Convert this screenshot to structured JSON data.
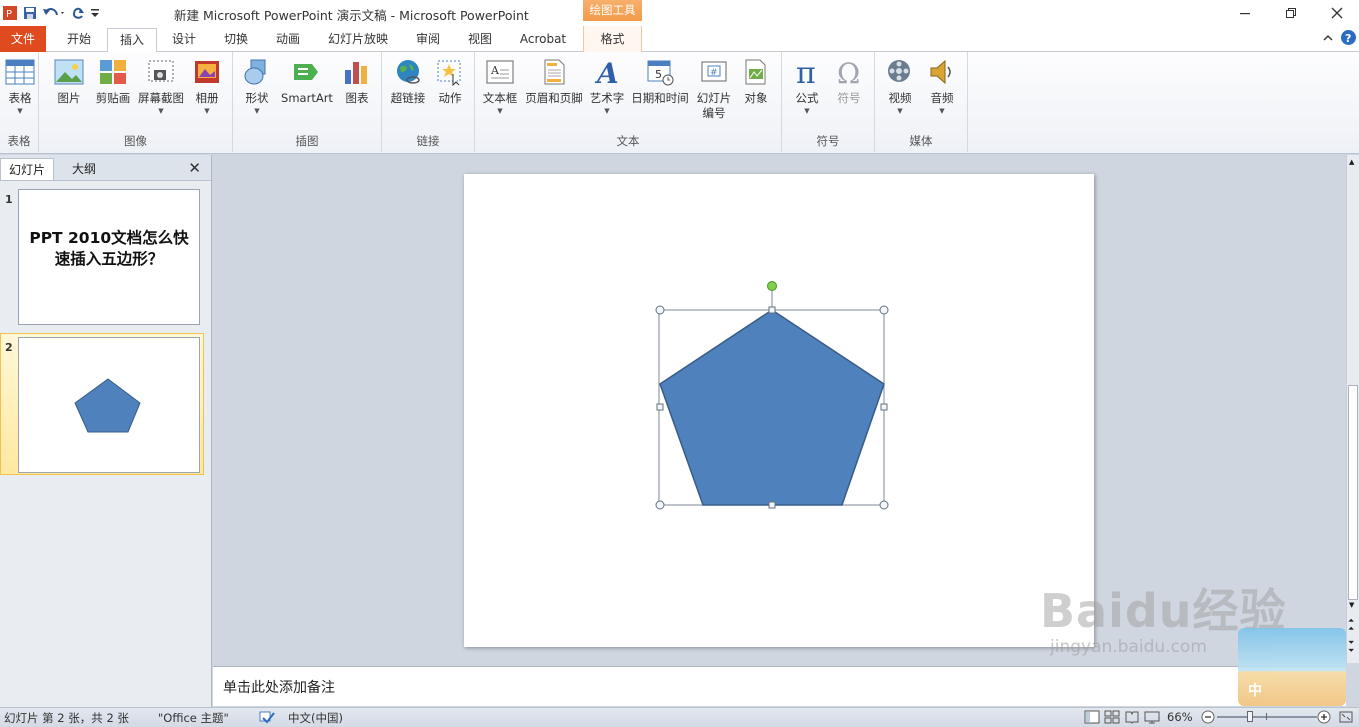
{
  "window": {
    "title": "新建 Microsoft PowerPoint 演示文稿 - Microsoft PowerPoint",
    "context_tab_header": "绘图工具",
    "controls": [
      "minimize-icon",
      "maximize-icon",
      "close-icon"
    ]
  },
  "quick_access": [
    "powerpoint-logo-icon",
    "save-icon",
    "undo-icon",
    "redo-icon",
    "customize-icon"
  ],
  "tabs": {
    "file": "文件",
    "home": "开始",
    "insert": "插入",
    "design": "设计",
    "transitions": "切换",
    "animations": "动画",
    "slideshow": "幻灯片放映",
    "review": "审阅",
    "view": "视图",
    "acrobat": "Acrobat",
    "format": "格式",
    "active": "插入"
  },
  "ribbon": {
    "groups": {
      "tables": "表格",
      "images": "图像",
      "illustrations": "插图",
      "links": "链接",
      "text": "文本",
      "symbols": "符号",
      "media": "媒体"
    },
    "buttons": {
      "table": "表格",
      "picture": "图片",
      "clipart": "剪贴画",
      "screenshot": "屏幕截图",
      "album": "相册",
      "shapes": "形状",
      "smartart": "SmartArt",
      "chart": "图表",
      "hyperlink": "超链接",
      "action": "动作",
      "textbox": "文本框",
      "header_footer": "页眉和页脚",
      "wordart": "艺术字",
      "datetime": "日期和时间",
      "slide_number_1": "幻灯片",
      "slide_number_2": "编号",
      "object": "对象",
      "equation": "公式",
      "symbol": "符号",
      "video": "视频",
      "audio": "音频"
    }
  },
  "left_panel": {
    "tab_slides": "幻灯片",
    "tab_outline": "大纲",
    "slides": [
      {
        "number": "1",
        "title_line1": "PPT 2010文档怎么快",
        "title_line2": "速插入五边形？"
      },
      {
        "number": "2"
      }
    ]
  },
  "notes_placeholder": "单击此处添加备注",
  "status": {
    "slide_info": "幻灯片 第 2 张，共 2 张",
    "theme": "\"Office 主题\"",
    "language": "中文(中国)",
    "zoom": "66%"
  },
  "watermark": {
    "brand": "Baidu经验",
    "url": "jingyan.baidu.com"
  },
  "colors": {
    "file_tab": "#e04a1f",
    "context_tab": "#f39b4a",
    "pentagon_fill": "#4f81bd",
    "pentagon_stroke": "#385d8a",
    "rotation_handle": "#7ed04a"
  }
}
